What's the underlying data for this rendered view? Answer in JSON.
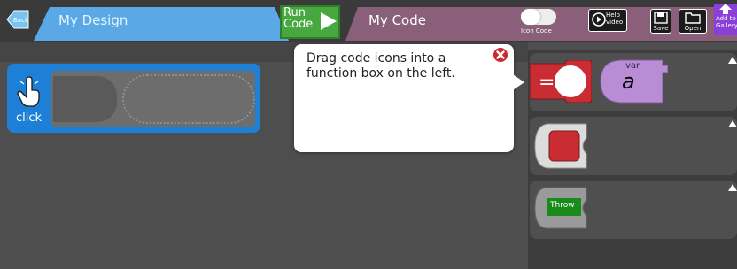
{
  "header": {
    "back_label": "Back",
    "design_tab_label": "My Design",
    "run_label": "Run\nCode",
    "code_tab_label": "My Code",
    "icon_code_label": "Icon Code",
    "help_label": "Help\nvideo",
    "save_label": "Save",
    "open_label": "Open",
    "gallery_label": "Add to\nGallery"
  },
  "workspace": {
    "event_label": "click"
  },
  "palette": {
    "throw_label": "Throw",
    "var_label": "var",
    "var_name": "a"
  },
  "tooltip": {
    "text": "Drag code icons into a function box on the left."
  },
  "colors": {
    "design_tab": "#5aa9e6",
    "code_tab": "#8a5f7a",
    "event_block": "#1e7fd6",
    "run_button": "#47a83f",
    "equals_block": "#c92c33",
    "var_block": "#b98cd6",
    "throw_block": "#1a8a1a",
    "gallery_button": "#8a3fd6"
  }
}
